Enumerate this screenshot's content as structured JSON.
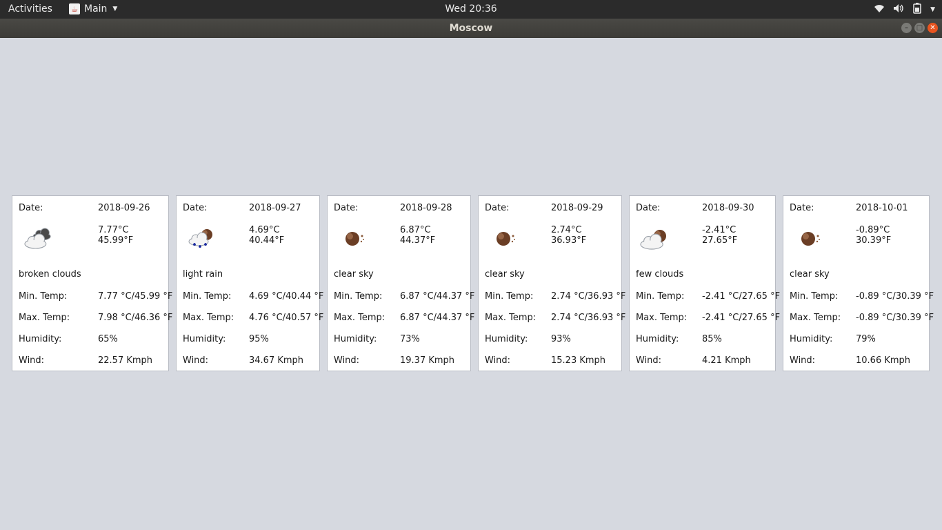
{
  "topbar": {
    "activities": "Activities",
    "app_menu": "Main",
    "clock": "Wed 20:36"
  },
  "window": {
    "title": "Moscow"
  },
  "labels": {
    "date": "Date:",
    "min_temp": "Min. Temp:",
    "max_temp": "Max. Temp:",
    "humidity": "Humidity:",
    "wind": "Wind:"
  },
  "forecast": [
    {
      "date": "2018-09-26",
      "icon": "broken-clouds-icon",
      "temp_c": "7.77°C",
      "temp_f": "45.99°F",
      "description": "broken clouds",
      "min_temp": "7.77 °C/45.99 °F",
      "max_temp": "7.98 °C/46.36 °F",
      "humidity": "65%",
      "wind": "22.57 Kmph"
    },
    {
      "date": "2018-09-27",
      "icon": "light-rain-icon",
      "temp_c": "4.69°C",
      "temp_f": "40.44°F",
      "description": "light rain",
      "min_temp": "4.69 °C/40.44 °F",
      "max_temp": "4.76 °C/40.57 °F",
      "humidity": "95%",
      "wind": "34.67 Kmph"
    },
    {
      "date": "2018-09-28",
      "icon": "clear-night-icon",
      "temp_c": "6.87°C",
      "temp_f": "44.37°F",
      "description": "clear sky",
      "min_temp": "6.87 °C/44.37 °F",
      "max_temp": "6.87 °C/44.37 °F",
      "humidity": "73%",
      "wind": "19.37 Kmph"
    },
    {
      "date": "2018-09-29",
      "icon": "clear-night-icon",
      "temp_c": "2.74°C",
      "temp_f": "36.93°F",
      "description": "clear sky",
      "min_temp": "2.74 °C/36.93 °F",
      "max_temp": "2.74 °C/36.93 °F",
      "humidity": "93%",
      "wind": "15.23 Kmph"
    },
    {
      "date": "2018-09-30",
      "icon": "few-clouds-night-icon",
      "temp_c": "-2.41°C",
      "temp_f": "27.65°F",
      "description": "few clouds",
      "min_temp": "-2.41 °C/27.65 °F",
      "max_temp": "-2.41 °C/27.65 °F",
      "humidity": "85%",
      "wind": "4.21 Kmph"
    },
    {
      "date": "2018-10-01",
      "icon": "clear-night-icon",
      "temp_c": "-0.89°C",
      "temp_f": "30.39°F",
      "description": "clear sky",
      "min_temp": "-0.89 °C/30.39 °F",
      "max_temp": "-0.89 °C/30.39 °F",
      "humidity": "79%",
      "wind": "10.66 Kmph"
    }
  ]
}
